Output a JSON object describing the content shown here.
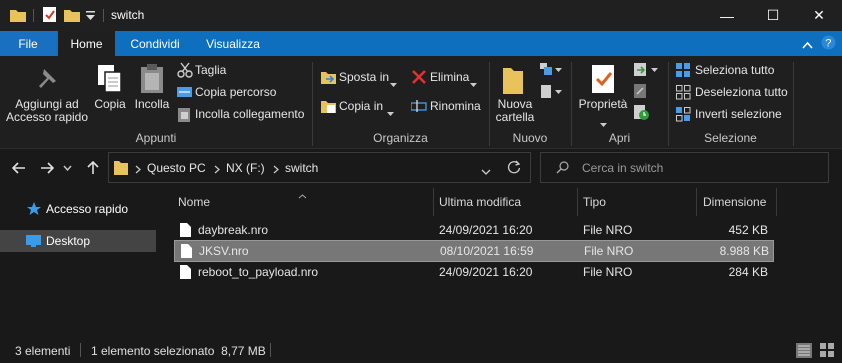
{
  "window": {
    "title": "switch",
    "minimize_glyph": "—",
    "maximize_glyph": "☐",
    "close_glyph": "✕"
  },
  "ribbon_tabs": {
    "file": "File",
    "home": "Home",
    "share": "Condividi",
    "view": "Visualizza"
  },
  "ribbon": {
    "pin_line1": "Aggiungi ad",
    "pin_line2": "Accesso rapido",
    "copy": "Copia",
    "paste": "Incolla",
    "cut": "Taglia",
    "copy_path": "Copia percorso",
    "paste_shortcut": "Incolla collegamento",
    "move_to": "Sposta in",
    "copy_to": "Copia in",
    "delete": "Elimina",
    "rename": "Rinomina",
    "new_folder_line1": "Nuova",
    "new_folder_line2": "cartella",
    "properties": "Proprietà",
    "select_all": "Seleziona tutto",
    "select_none": "Deseleziona tutto",
    "invert_selection": "Inverti selezione",
    "groups": {
      "clipboard": "Appunti",
      "organize": "Organizza",
      "new": "Nuovo",
      "open": "Apri",
      "select": "Selezione"
    }
  },
  "address": {
    "crumbs": [
      "Questo PC",
      "NX (F:)",
      "switch"
    ],
    "search_placeholder": "Cerca in switch"
  },
  "nav": {
    "quick_access": "Accesso rapido",
    "desktop": "Desktop"
  },
  "columns": {
    "name": "Nome",
    "modified": "Ultima modifica",
    "type": "Tipo",
    "size": "Dimensione"
  },
  "files": [
    {
      "name": "daybreak.nro",
      "modified": "24/09/2021 16:20",
      "type": "File NRO",
      "size": "452 KB",
      "selected": false
    },
    {
      "name": "JKSV.nro",
      "modified": "08/10/2021 16:59",
      "type": "File NRO",
      "size": "8.988 KB",
      "selected": true
    },
    {
      "name": "reboot_to_payload.nro",
      "modified": "24/09/2021 16:20",
      "type": "File NRO",
      "size": "284 KB",
      "selected": false
    }
  ],
  "status": {
    "count": "3 elementi",
    "selection": "1 elemento selezionato  8,77 MB"
  },
  "colors": {
    "accent": "#0d6fbe",
    "folder": "#e8c25a",
    "background": "#191919"
  }
}
